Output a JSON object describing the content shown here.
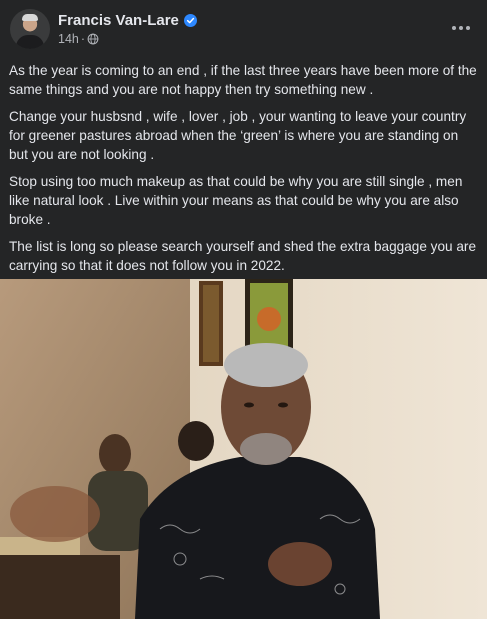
{
  "post": {
    "author": "Francis Van-Lare",
    "time": "14h",
    "separator": "·",
    "paragraphs": [
      "As the year is coming to an end , if the last three years have been more of the same things and you are not happy then try something new .",
      "Change your husbsnd , wife , lover , job , your wanting to leave your country for greener pastures abroad when the ‘green’ is where you are standing on but you are not looking .",
      "Stop using too much makeup as that could be why you are still single , men like natural look . Live within your means as that could be why you are also broke .",
      "The list is long so please search yourself and shed the extra baggage you are carrying so that it does not follow you in 2022."
    ]
  },
  "icons": {
    "verified": "verified-badge-icon",
    "audience": "globe-icon",
    "more": "more-options-icon"
  },
  "colors": {
    "background": "#242526",
    "text": "#e4e6eb",
    "secondary_text": "#b0b3b8",
    "verified": "#2d88ff"
  }
}
